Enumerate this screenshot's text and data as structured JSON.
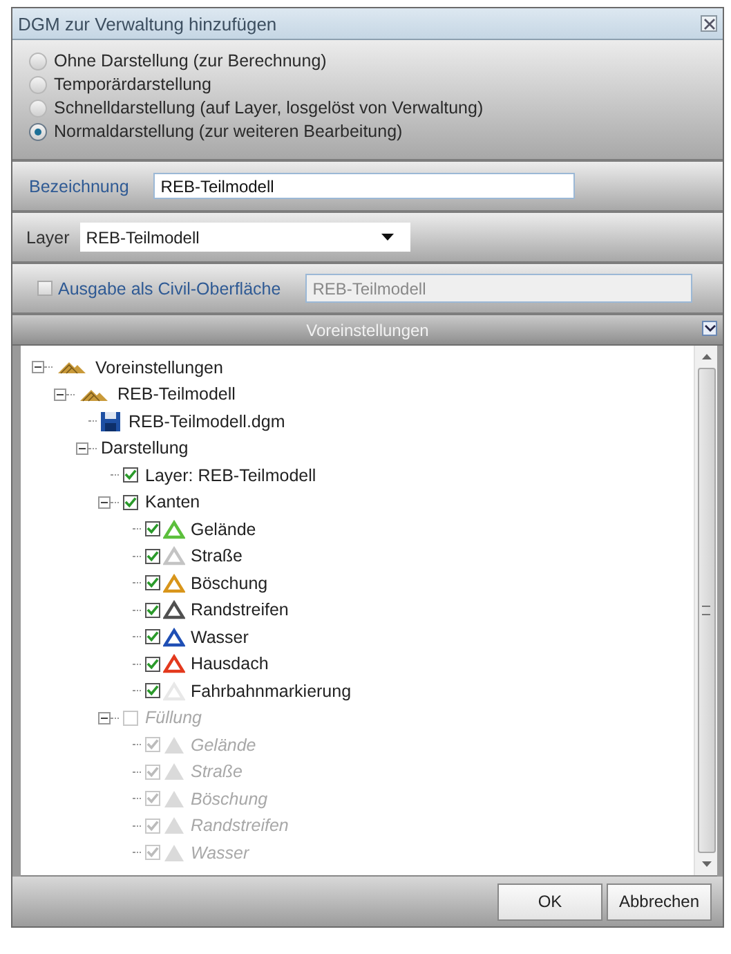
{
  "window": {
    "title": "DGM zur Verwaltung hinzufügen"
  },
  "display_modes": [
    {
      "label": "Ohne Darstellung (zur Berechnung)",
      "selected": false
    },
    {
      "label": "Temporärdarstellung",
      "selected": false
    },
    {
      "label": "Schnelldarstellung (auf Layer, losgelöst von Verwaltung)",
      "selected": false
    },
    {
      "label": "Normaldarstellung (zur weiteren Bearbeitung)",
      "selected": true
    }
  ],
  "name_field": {
    "label": "Bezeichnung",
    "value": "REB-Teilmodell"
  },
  "layer_field": {
    "label": "Layer",
    "value": "REB-Teilmodell"
  },
  "civil_output": {
    "label": "Ausgabe als Civil-Oberfläche",
    "checked": false,
    "value": "REB-Teilmodell"
  },
  "presets": {
    "title": "Voreinstellungen",
    "tree": [
      {
        "label": "Voreinstellungen",
        "kind": "model",
        "expanded": true,
        "children": [
          {
            "label": "REB-Teilmodell",
            "kind": "model",
            "expanded": true,
            "children": [
              {
                "label": "REB-Teilmodell.dgm",
                "kind": "file"
              },
              {
                "label": "Darstellung",
                "kind": "group",
                "expanded": true,
                "children": [
                  {
                    "label": "Layer: REB-Teilmodell",
                    "kind": "check",
                    "checked": true,
                    "disabled": false
                  },
                  {
                    "label": "Kanten",
                    "kind": "check",
                    "checked": true,
                    "disabled": false,
                    "expanded": true,
                    "children": [
                      {
                        "label": "Gelände",
                        "kind": "edge",
                        "checked": true,
                        "disabled": false,
                        "color": "#5cbf3c"
                      },
                      {
                        "label": "Straße",
                        "kind": "edge",
                        "checked": true,
                        "disabled": false,
                        "color": "#c4c4c4"
                      },
                      {
                        "label": "Böschung",
                        "kind": "edge",
                        "checked": true,
                        "disabled": false,
                        "color": "#d8951a"
                      },
                      {
                        "label": "Randstreifen",
                        "kind": "edge",
                        "checked": true,
                        "disabled": false,
                        "color": "#505050"
                      },
                      {
                        "label": "Wasser",
                        "kind": "edge",
                        "checked": true,
                        "disabled": false,
                        "color": "#1f4fb5"
                      },
                      {
                        "label": "Hausdach",
                        "kind": "edge",
                        "checked": true,
                        "disabled": false,
                        "color": "#e3391d"
                      },
                      {
                        "label": "Fahrbahnmarkierung",
                        "kind": "edge",
                        "checked": true,
                        "disabled": false,
                        "color": "#e8e8e8"
                      }
                    ]
                  },
                  {
                    "label": "Füllung",
                    "kind": "check",
                    "checked": false,
                    "disabled": true,
                    "expanded": true,
                    "children": [
                      {
                        "label": "Gelände",
                        "kind": "fill",
                        "checked": true,
                        "disabled": true,
                        "color": "#dadada"
                      },
                      {
                        "label": "Straße",
                        "kind": "fill",
                        "checked": true,
                        "disabled": true,
                        "color": "#dadada"
                      },
                      {
                        "label": "Böschung",
                        "kind": "fill",
                        "checked": true,
                        "disabled": true,
                        "color": "#dadada"
                      },
                      {
                        "label": "Randstreifen",
                        "kind": "fill",
                        "checked": true,
                        "disabled": true,
                        "color": "#dadada"
                      },
                      {
                        "label": "Wasser",
                        "kind": "fill",
                        "checked": true,
                        "disabled": true,
                        "color": "#dadada"
                      }
                    ]
                  }
                ]
              }
            ]
          }
        ]
      }
    ]
  },
  "buttons": [
    {
      "label": "OK"
    },
    {
      "label": "Abbrechen"
    }
  ]
}
